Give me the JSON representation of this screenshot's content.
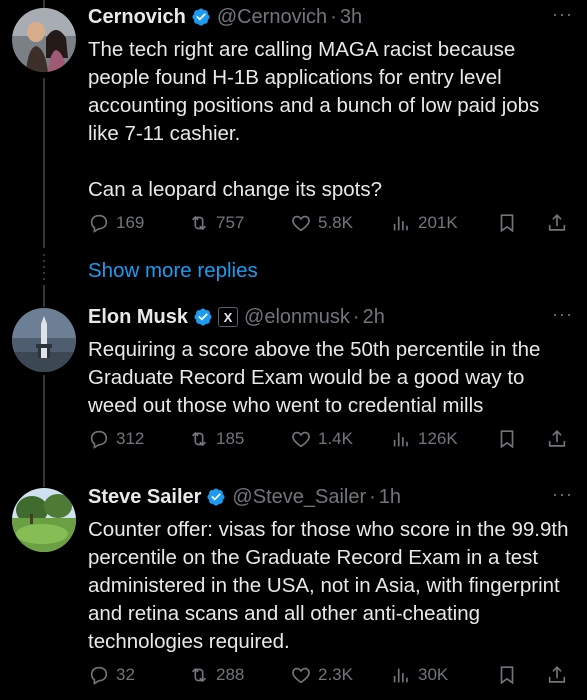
{
  "show_more_label": "Show more replies",
  "tweets": [
    {
      "name": "Cernovich",
      "handle": "@Cernovich",
      "time": "3h",
      "text": "The tech right are calling MAGA racist because people found H-1B applications for entry level accounting positions and a bunch of low paid jobs like 7-11 cashier.\n\nCan a leopard change its spots?",
      "replies": "169",
      "reposts": "757",
      "likes": "5.8K",
      "views": "201K"
    },
    {
      "name": "Elon Musk",
      "handle": "@elonmusk",
      "time": "2h",
      "text": "Requiring a score above the 50th percentile in the Graduate Record Exam would be a good way to weed out those who went to credential mills",
      "replies": "312",
      "reposts": "185",
      "likes": "1.4K",
      "views": "126K"
    },
    {
      "name": "Steve Sailer",
      "handle": "@Steve_Sailer",
      "time": "1h",
      "text": "Counter offer: visas for those who score in the 99.9th percentile on the Graduate Record Exam in a test administered in the USA, not in Asia, with fingerprint and retina scans and all other anti-cheating technologies required.",
      "replies": "32",
      "reposts": "288",
      "likes": "2.3K",
      "views": "30K"
    }
  ],
  "colors": {
    "background": "#000000",
    "text": "#e7e9ea",
    "muted": "#71767b",
    "accent": "#1d9bf0",
    "line": "#333639"
  },
  "icons": [
    "verified-badge-icon",
    "x-affiliate-badge-icon",
    "more-icon",
    "reply-icon",
    "repost-icon",
    "like-icon",
    "views-icon",
    "bookmark-icon",
    "share-icon"
  ]
}
